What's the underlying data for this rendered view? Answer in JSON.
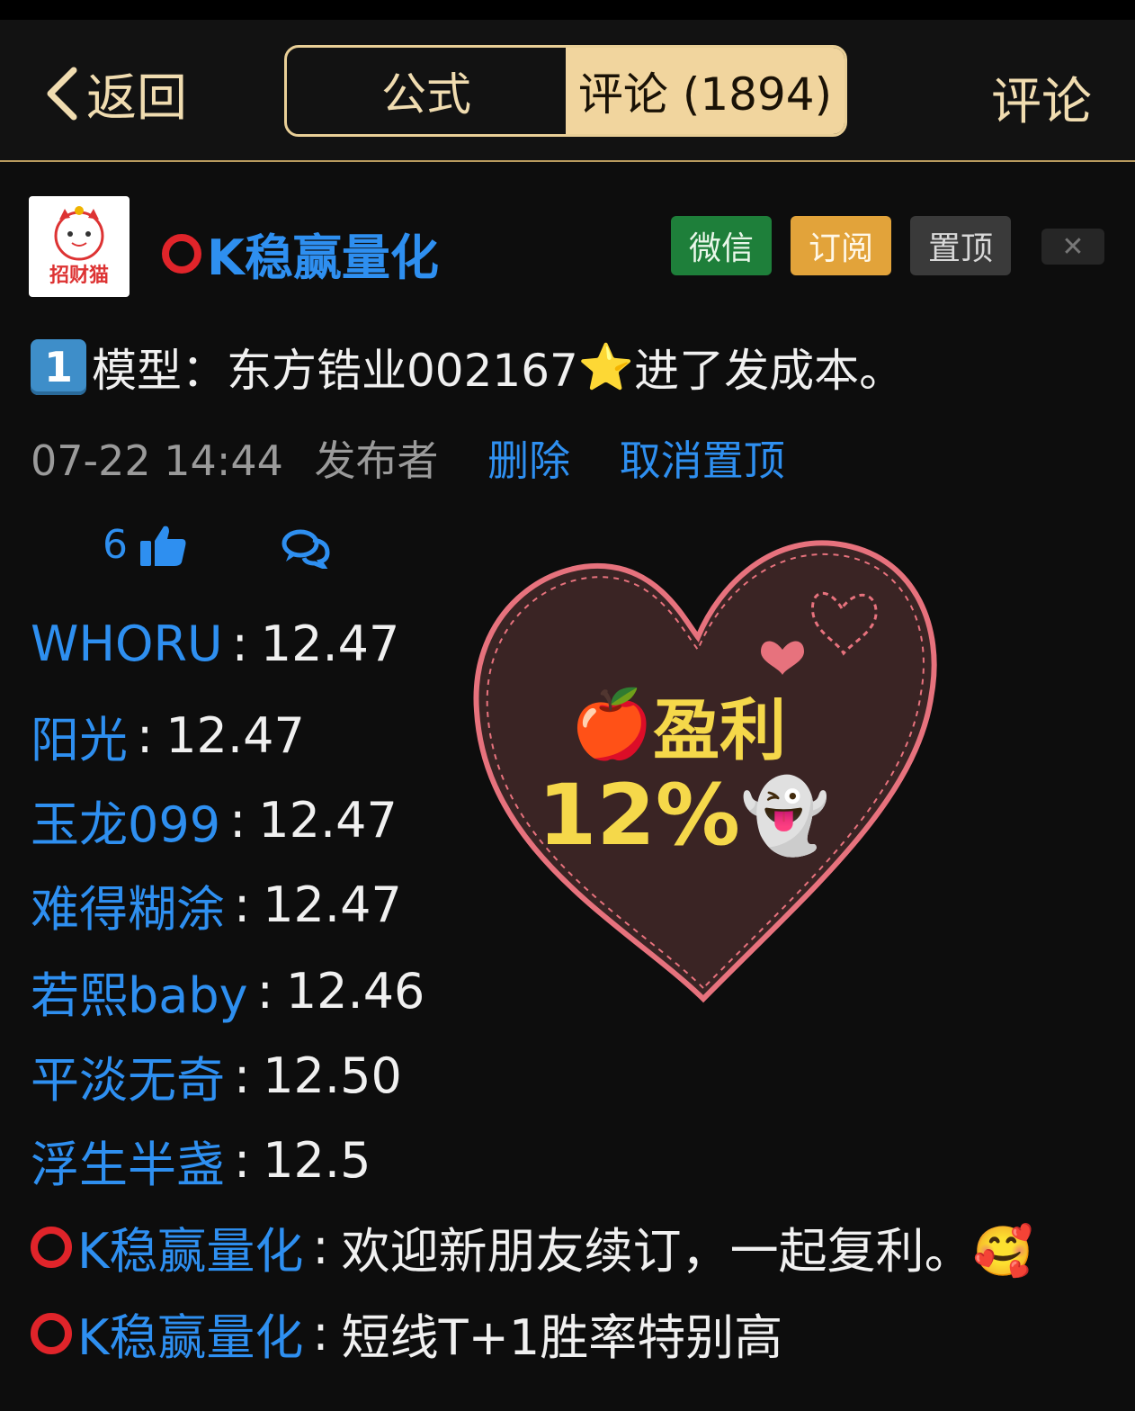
{
  "header": {
    "back_label": "返回",
    "tabs": [
      {
        "label": "公式",
        "active": false
      },
      {
        "label": "评论 (1894)",
        "active": true
      }
    ],
    "right_label": "评论"
  },
  "author": {
    "avatar_text": "招财猫",
    "name": "K稳赢量化",
    "buttons": {
      "wechat": "微信",
      "subscribe": "订阅",
      "pin": "置顶",
      "close": "✕"
    }
  },
  "post": {
    "number": "1",
    "text": "模型：东方锆业002167",
    "star": "⭐",
    "text_after": "进了发成本。",
    "time": "07-22 14:44",
    "publisher": "发布者",
    "delete": "删除",
    "unpin": "取消置顶",
    "likes": "6"
  },
  "replies": [
    {
      "user": "WHORU",
      "sep": ":",
      "text": "12.47",
      "ring": false
    },
    {
      "user": "阳光",
      "sep": ":",
      "text": "12.47",
      "ring": false
    },
    {
      "user": "玉龙099",
      "sep": ":",
      "text": "12.47",
      "ring": false
    },
    {
      "user": "难得糊涂",
      "sep": ":",
      "text": "12.47",
      "ring": false
    },
    {
      "user": "若熙baby",
      "sep": ":",
      "text": "12.46",
      "ring": false
    },
    {
      "user": "平淡无奇",
      "sep": ":",
      "text": "12.50",
      "ring": false
    },
    {
      "user": "浮生半盏",
      "sep": ":",
      "text": "12.5",
      "ring": false
    },
    {
      "user": "K稳赢量化",
      "sep": ":",
      "text": "欢迎新朋友续订，一起复利。🥰",
      "ring": true
    },
    {
      "user": "K稳赢量化",
      "sep": ":",
      "text": "短线T+1胜率特别高",
      "ring": true
    }
  ],
  "sticker": {
    "line1_emoji": "🍎",
    "line1": "盈利",
    "line2": "12%",
    "line2_emoji": "👻"
  },
  "colors": {
    "accent_gold": "#f1d59e",
    "link_blue": "#2e8ff0",
    "wechat_green": "#1e7f3a",
    "subscribe_orange": "#e2a33a"
  }
}
